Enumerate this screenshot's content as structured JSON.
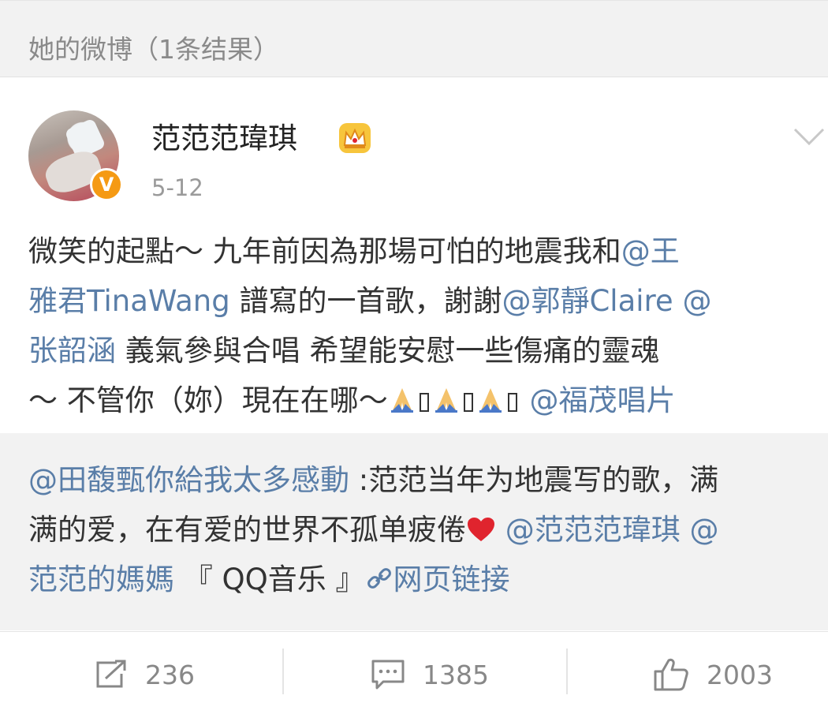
{
  "section": {
    "title": "她的微博（1条结果）"
  },
  "post": {
    "author": "范范范瑋琪",
    "badge": "V",
    "time": "5-12",
    "lines": [
      [
        "微笑的起點～ 九年前因為那場可怕的地震我和",
        "@王"
      ],
      [
        "雅君TinaWang",
        " 譜寫的一首歌，謝謝",
        "@郭靜Claire @"
      ],
      [
        "张韶涵",
        " 義氣參與合唱 希望能安慰一些傷痛的靈魂"
      ],
      [
        "～ 不管你（妳）現在在哪～",
        "@福茂唱片"
      ]
    ]
  },
  "repost": {
    "lines": [
      [
        "@田馥甄你給我太多感動",
        " :范范当年为地震写的歌，满"
      ],
      [
        "满的爱，在有爱的世界不孤单疲倦",
        "@范范范瑋琪 @"
      ],
      [
        "范范的媽媽",
        " 『 QQ音乐 』",
        "网页链接"
      ]
    ]
  },
  "actions": {
    "reposts": "236",
    "comments": "1385",
    "likes": "2003"
  },
  "icons": {
    "crown": "crown-icon",
    "chevron": "chevron-down-icon",
    "pray": "pray-icon",
    "heart": "heart-icon",
    "link": "link-chain-icon",
    "repost": "repost-icon",
    "comment": "comment-icon",
    "like": "thumbs-up-icon"
  },
  "colors": {
    "link": "#5a7ea8",
    "badge": "#f59a14",
    "heart": "#e0242e",
    "background_gray": "#f2f2f2"
  }
}
